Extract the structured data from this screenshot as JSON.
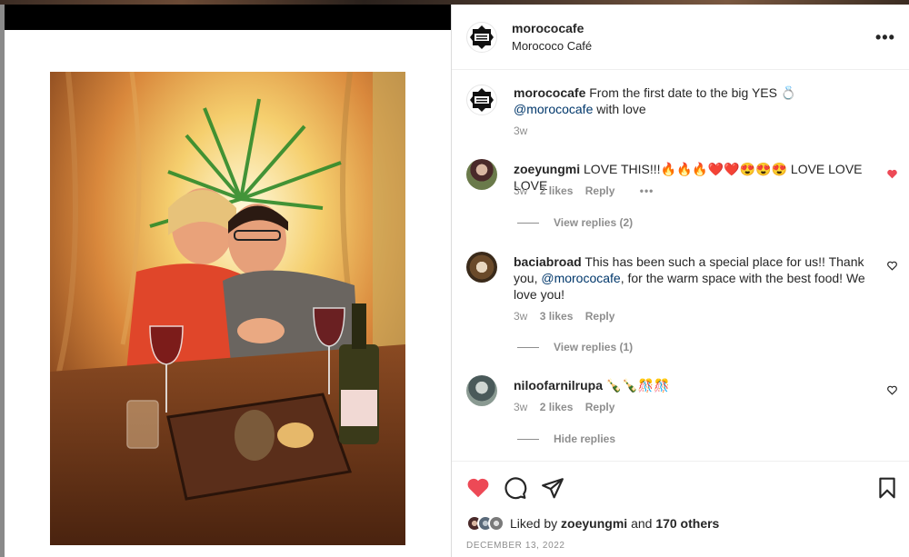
{
  "post": {
    "username": "morococafe",
    "display_name": "Morococo Café"
  },
  "caption": {
    "username": "morococafe",
    "text": "From the first date to the big YES 💍",
    "mention": "@morococafe",
    "text_after": "with love",
    "age": "3w"
  },
  "comments": [
    {
      "username": "zoeyungmi",
      "text": "LOVE THIS!!!🔥🔥🔥❤️❤️😍😍😍 LOVE LOVE LOVE",
      "age": "3w",
      "likes": "2 likes",
      "reply": "Reply",
      "more": "•••",
      "replies_toggle": "View replies (2)",
      "liked": true
    },
    {
      "username": "baciabroad",
      "text_before": "This has been such a special place for us!! Thank you,",
      "mention": "@morococafe",
      "text_after": ", for the warm space with the best food! We love you!",
      "age": "3w",
      "likes": "3 likes",
      "reply": "Reply",
      "replies_toggle": "View replies (1)",
      "liked": false
    },
    {
      "username": "niloofarnilrupa",
      "text": "🍾🍾🎊🎊",
      "age": "3w",
      "likes": "2 likes",
      "reply": "Reply",
      "replies_toggle": "Hide replies",
      "liked": false
    }
  ],
  "footer": {
    "liked_by_label": "Liked by",
    "liked_by_user": "zoeyungmi",
    "and_label": "and",
    "others": "170 others",
    "date": "DECEMBER 13, 2022"
  },
  "colors": {
    "heart_red": "#ed4956",
    "mention_blue": "#00376b",
    "meta_gray": "#8e8e8e"
  },
  "icons": [
    "more-icon",
    "heart-icon",
    "comment-icon",
    "share-icon",
    "bookmark-icon"
  ]
}
